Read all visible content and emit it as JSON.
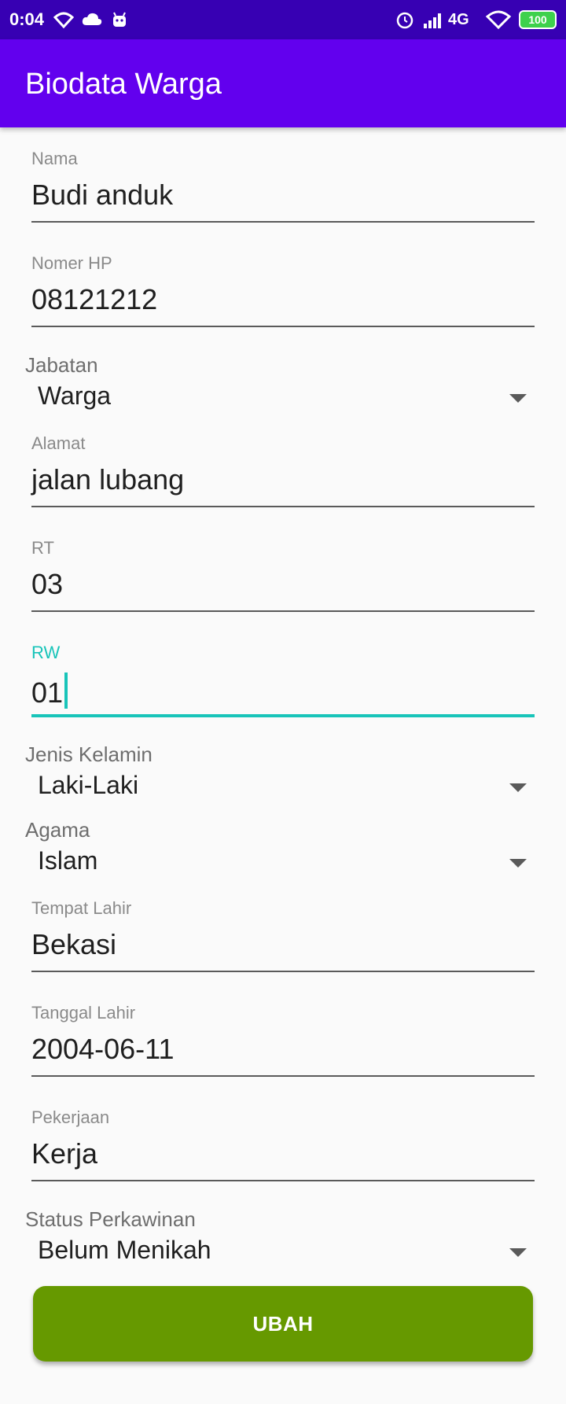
{
  "status_bar": {
    "time": "0:04",
    "network": "4G",
    "battery": "100",
    "icons": [
      "wifi-icon",
      "cloud-icon",
      "android-icon",
      "alarm-icon",
      "signal-icon",
      "wifi-icon",
      "battery-icon"
    ]
  },
  "app": {
    "title": "Biodata Warga",
    "primary_color": "#6200ee",
    "status_color": "#3700b3"
  },
  "form": {
    "nama": {
      "label": "Nama",
      "value": "Budi anduk"
    },
    "nomer_hp": {
      "label": "Nomer HP",
      "value": "08121212"
    },
    "jabatan": {
      "label": "Jabatan",
      "value": "Warga"
    },
    "alamat": {
      "label": "Alamat",
      "value": "jalan lubang"
    },
    "rt": {
      "label": "RT",
      "value": "03"
    },
    "rw": {
      "label": "RW",
      "value": "01",
      "focused": true
    },
    "jenis_kelamin": {
      "label": "Jenis Kelamin",
      "value": "Laki-Laki"
    },
    "agama": {
      "label": "Agama",
      "value": "Islam"
    },
    "tempat_lahir": {
      "label": "Tempat Lahir",
      "value": "Bekasi"
    },
    "tanggal_lahir": {
      "label": "Tanggal Lahir",
      "value": "2004-06-11"
    },
    "pekerjaan": {
      "label": "Pekerjaan",
      "value": "Kerja"
    },
    "status_perkawinan": {
      "label": "Status Perkawinan",
      "value": "Belum Menikah"
    }
  },
  "submit": {
    "label": "UBAH",
    "color": "#669900"
  },
  "accent_color": "#18c4b9"
}
